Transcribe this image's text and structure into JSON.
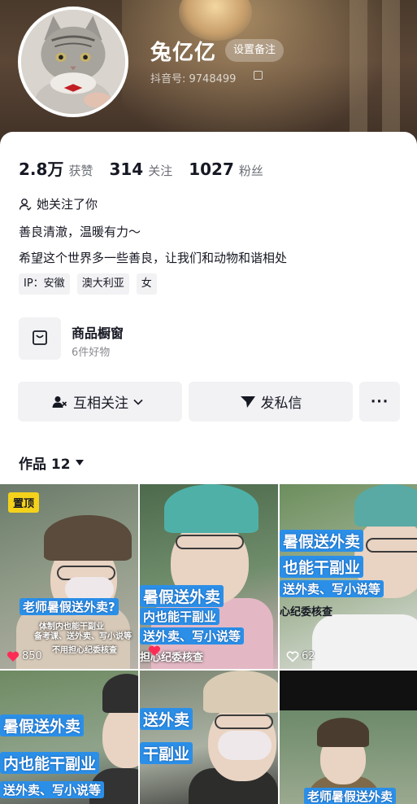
{
  "profile": {
    "name": "兔亿亿",
    "remark_button": "设置备注",
    "douyin_id": "抖音号: 9748499"
  },
  "stats": [
    {
      "value": "2.8万",
      "label": "获赞"
    },
    {
      "value": "314",
      "label": "关注"
    },
    {
      "value": "1027",
      "label": "粉丝"
    }
  ],
  "follows_you": "她关注了你",
  "bio": {
    "line1": "善良清澈，温暖有力～",
    "line2": "希望这个世界多一些善良，让我们和动物和谐相处"
  },
  "tags": [
    "IP：安徽",
    "澳大利亚",
    "女"
  ],
  "shop": {
    "title": "商品橱窗",
    "subtitle": "6件好物"
  },
  "buttons": {
    "follow": "互相关注",
    "message": "发私信",
    "more": "···"
  },
  "works": {
    "label": "作品 12"
  },
  "videos": [
    {
      "pinned": "置顶",
      "caption1": "老师暑假送外卖?",
      "caption2": "体制内也能干副业",
      "caption3": "备考课、送外卖、写小说等",
      "caption4": "不用担心纪委核查",
      "likes": "850",
      "liked": true
    },
    {
      "caption1": "暑假送外卖",
      "caption2": "内也能干副业",
      "caption3": "送外卖、写小说等",
      "caption4": "担心纪委核查",
      "liked": true
    },
    {
      "caption1": "暑假送外卖",
      "caption2": "也能干副业",
      "caption3": "送外卖、写小说等",
      "caption4": "心纪委核查",
      "likes": "62",
      "liked": false
    },
    {
      "caption1": "暑假送外卖",
      "caption2": "内也能干副业",
      "caption3": "送外卖、写小说等"
    },
    {
      "caption1": "送外卖",
      "caption2": "干副业"
    },
    {
      "caption1": "老师暑假送外卖"
    }
  ],
  "colors": {
    "caption_blue": "#2b8fe8",
    "pin_yellow": "#f4d21b",
    "like_red": "#fe2c55"
  }
}
